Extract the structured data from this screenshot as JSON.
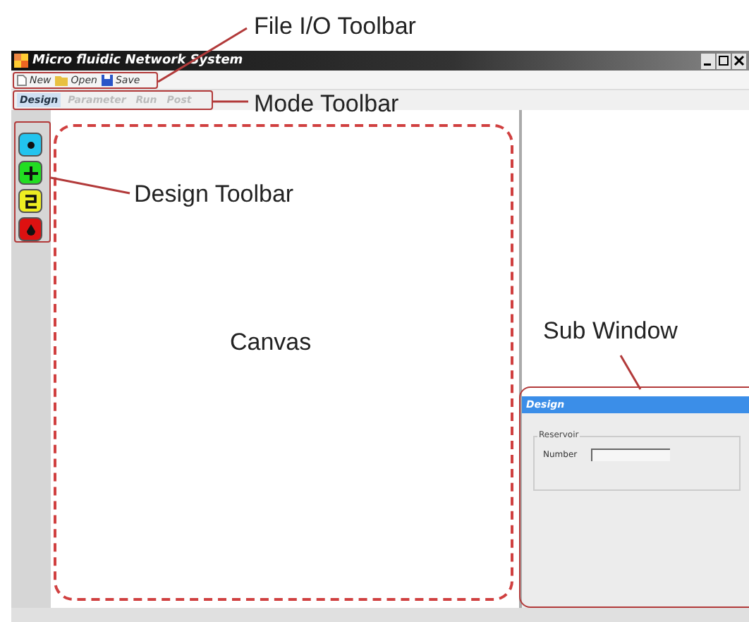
{
  "annotations": [
    {
      "label": "File I/O Toolbar"
    },
    {
      "label": "Mode Toolbar"
    },
    {
      "label": "Design Toolbar"
    },
    {
      "label": "Canvas"
    },
    {
      "label": "Sub Window"
    }
  ],
  "window": {
    "title": "Micro fluidic Network System"
  },
  "file_toolbar": [
    {
      "label": "New",
      "kind": "new"
    },
    {
      "label": "Open",
      "kind": "open"
    },
    {
      "label": "Save",
      "kind": "save"
    }
  ],
  "mode_tabs": [
    {
      "label": "Design",
      "selected": true
    },
    {
      "label": "Parameter",
      "selected": false
    },
    {
      "label": "Run",
      "selected": false
    },
    {
      "label": "Post",
      "selected": false
    }
  ],
  "design_tools": [
    {
      "kind": "reservoir",
      "color": "#22c4ee"
    },
    {
      "kind": "junction",
      "color": "#22dd22"
    },
    {
      "kind": "channel",
      "color": "#eeee22"
    },
    {
      "kind": "outlet",
      "color": "#dd1111"
    }
  ],
  "sub_window": {
    "title": "Design",
    "group": "Reservoir",
    "field_label": "Number"
  }
}
